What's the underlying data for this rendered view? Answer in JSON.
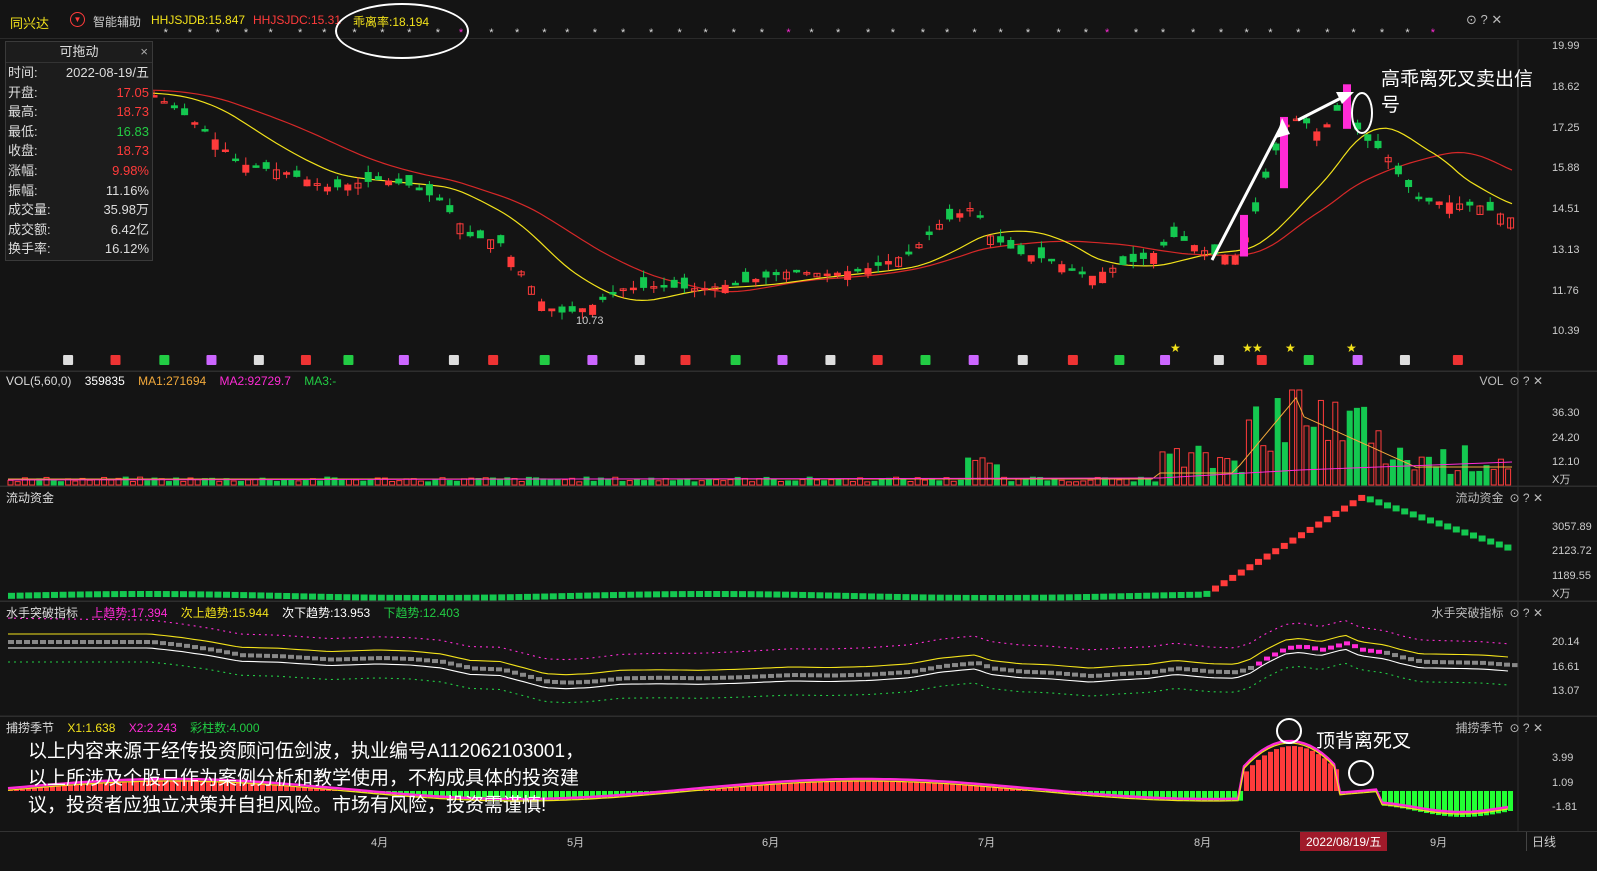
{
  "top": {
    "stock_name": "同兴达",
    "assist_label": "智能辅助",
    "hhjsjdb": "HHJSJDB:15.847",
    "hhjsjdc": "HHJSJDC:15.31",
    "deviation": "乖离率:18.194"
  },
  "info_box": {
    "title": "可拖动",
    "close": "×",
    "rows": [
      {
        "label": "时间:",
        "value": "2022-08-19/五",
        "color": "#dddddd"
      },
      {
        "label": "开盘:",
        "value": "17.05",
        "color": "#ff3b3b"
      },
      {
        "label": "最高:",
        "value": "18.73",
        "color": "#ff3b3b"
      },
      {
        "label": "最低:",
        "value": "16.83",
        "color": "#22cc44"
      },
      {
        "label": "收盘:",
        "value": "18.73",
        "color": "#ff3b3b"
      },
      {
        "label": "涨幅:",
        "value": "9.98%",
        "color": "#ff3b3b"
      },
      {
        "label": "振幅:",
        "value": "11.16%",
        "color": "#dddddd"
      },
      {
        "label": "成交量:",
        "value": "35.98万",
        "color": "#dddddd"
      },
      {
        "label": "成交额:",
        "value": "6.42亿",
        "color": "#dddddd"
      },
      {
        "label": "换手率:",
        "value": "16.12%",
        "color": "#dddddd"
      }
    ]
  },
  "price_axis": [
    "19.99",
    "18.62",
    "17.25",
    "15.88",
    "14.51",
    "13.13",
    "11.76",
    "10.39"
  ],
  "low_label": "10.73",
  "annotations": {
    "sell_signal": "高乖离死叉卖出信号",
    "top_divergence": "顶背离死叉"
  },
  "vol_panel": {
    "title": "VOL(5,60,0)",
    "value": "359835",
    "ma1": "MA1:271694",
    "ma2": "MA2:92729.7",
    "ma3": "MA3:-",
    "right_name": "VOL",
    "axis": [
      "36.30",
      "24.20",
      "12.10"
    ],
    "unit": "X万"
  },
  "flow_panel": {
    "title": "流动资金",
    "right_name": "流动资金",
    "axis": [
      "3057.89",
      "2123.72",
      "1189.55"
    ],
    "unit": "X万"
  },
  "trend_panel": {
    "title": "水手突破指标",
    "up": "上趋势:17.394",
    "sub_up": "次上趋势:15.944",
    "sub_down": "次下趋势:13.953",
    "down": "下趋势:12.403",
    "right_name": "水手突破指标",
    "axis": [
      "20.14",
      "16.61",
      "13.07"
    ]
  },
  "catch_panel": {
    "title": "捕捞季节",
    "x1": "X1:1.638",
    "x2": "X2:2.243",
    "bars": "彩柱数:4.000",
    "right_name": "捕捞季节",
    "axis": [
      "3.99",
      "1.09",
      "-1.81"
    ]
  },
  "disclaimer": "以上内容来源于经传投资顾问伍剑波，执业编号A112062103001，以上所涉及个股只作为案例分析和教学使用，不构成具体的投资建议，投资者应独立决策并自担风险。市场有风险，投资需谨慎!",
  "x_axis": {
    "months": [
      "4月",
      "5月",
      "6月",
      "7月",
      "8月",
      "9月"
    ],
    "cursor_date": "2022/08/19/五",
    "period": "日线"
  },
  "colors": {
    "up": "#ff3b3b",
    "down": "#14c850",
    "magenta": "#ff2bd6",
    "yellow": "#f2e21b",
    "bg": "#141414"
  }
}
